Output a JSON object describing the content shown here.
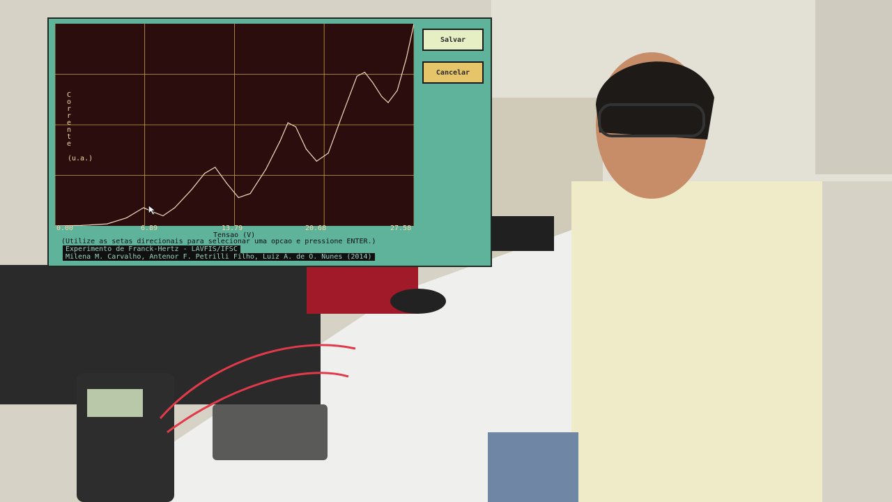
{
  "app": {
    "save_label": "Salvar",
    "cancel_label": "Cancelar",
    "instruction": "(Utilize as setas direcionais para selecionar uma opcao e pressione ENTER.)",
    "footer_title": "Experimento de Franck-Hertz - LAVFIS/IFSC",
    "footer_authors": "Milena M. Carvalho, Antenor F. Petrilli Filho, Luiz A. de O. Nunes (2014)",
    "colors": {
      "window_bg": "#5fb39b",
      "plot_bg": "#2a0d0c",
      "curve": "#f2dcc0",
      "grid": "#c7a24a",
      "save_bg": "#e6efc4",
      "cancel_bg": "#e6c46a"
    }
  },
  "chart_data": {
    "type": "line",
    "ylabel": "Corrente",
    "ylabel_chars": [
      "C",
      "o",
      "r",
      "r",
      "e",
      "n",
      "t",
      "e"
    ],
    "yunit": "(u.a.)",
    "xlabel": "Tensao (V)",
    "xticks": [
      "0.00",
      "6.89",
      "13.79",
      "20.68",
      "27.58"
    ],
    "xlim": [
      0,
      27.58
    ],
    "ylim": [
      0,
      1
    ],
    "grid": true,
    "series": [
      {
        "values": [
          [
            0,
            0.0
          ],
          [
            2.0,
            0.002
          ],
          [
            4.0,
            0.01
          ],
          [
            5.5,
            0.04
          ],
          [
            6.8,
            0.09
          ],
          [
            7.5,
            0.07
          ],
          [
            8.3,
            0.05
          ],
          [
            9.2,
            0.09
          ],
          [
            10.5,
            0.18
          ],
          [
            11.5,
            0.26
          ],
          [
            12.3,
            0.29
          ],
          [
            13.2,
            0.21
          ],
          [
            14.1,
            0.14
          ],
          [
            15.0,
            0.16
          ],
          [
            16.2,
            0.28
          ],
          [
            17.3,
            0.42
          ],
          [
            17.9,
            0.51
          ],
          [
            18.5,
            0.49
          ],
          [
            19.3,
            0.38
          ],
          [
            20.1,
            0.32
          ],
          [
            21.0,
            0.36
          ],
          [
            22.2,
            0.57
          ],
          [
            23.2,
            0.74
          ],
          [
            23.8,
            0.76
          ],
          [
            24.4,
            0.71
          ],
          [
            25.1,
            0.64
          ],
          [
            25.6,
            0.61
          ],
          [
            26.3,
            0.67
          ],
          [
            27.0,
            0.83
          ],
          [
            27.58,
            1.0
          ]
        ]
      }
    ]
  }
}
